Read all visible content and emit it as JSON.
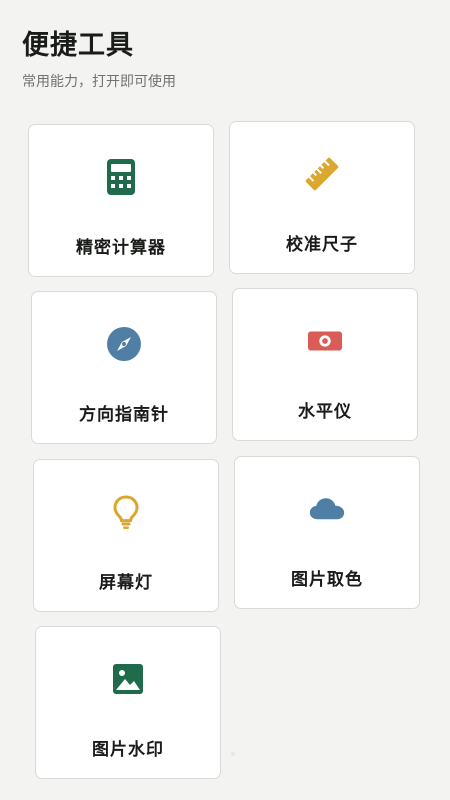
{
  "header": {
    "title": "便捷工具",
    "subtitle": "常用能力，打开即可使用"
  },
  "tools": [
    {
      "label": "精密计算器",
      "icon": "calculator-icon",
      "color": "#1f6b4b"
    },
    {
      "label": "校准尺子",
      "icon": "ruler-icon",
      "color": "#dca72f"
    },
    {
      "label": "方向指南针",
      "icon": "compass-icon",
      "color": "#4f7fa4"
    },
    {
      "label": "水平仪",
      "icon": "level-icon",
      "color": "#d95c57"
    },
    {
      "label": "屏幕灯",
      "icon": "lightbulb-icon",
      "color": "#dca72f"
    },
    {
      "label": "图片取色",
      "icon": "cloud-icon",
      "color": "#4f7fa4"
    },
    {
      "label": "图片水印",
      "icon": "image-icon",
      "color": "#1f6b4b"
    }
  ]
}
